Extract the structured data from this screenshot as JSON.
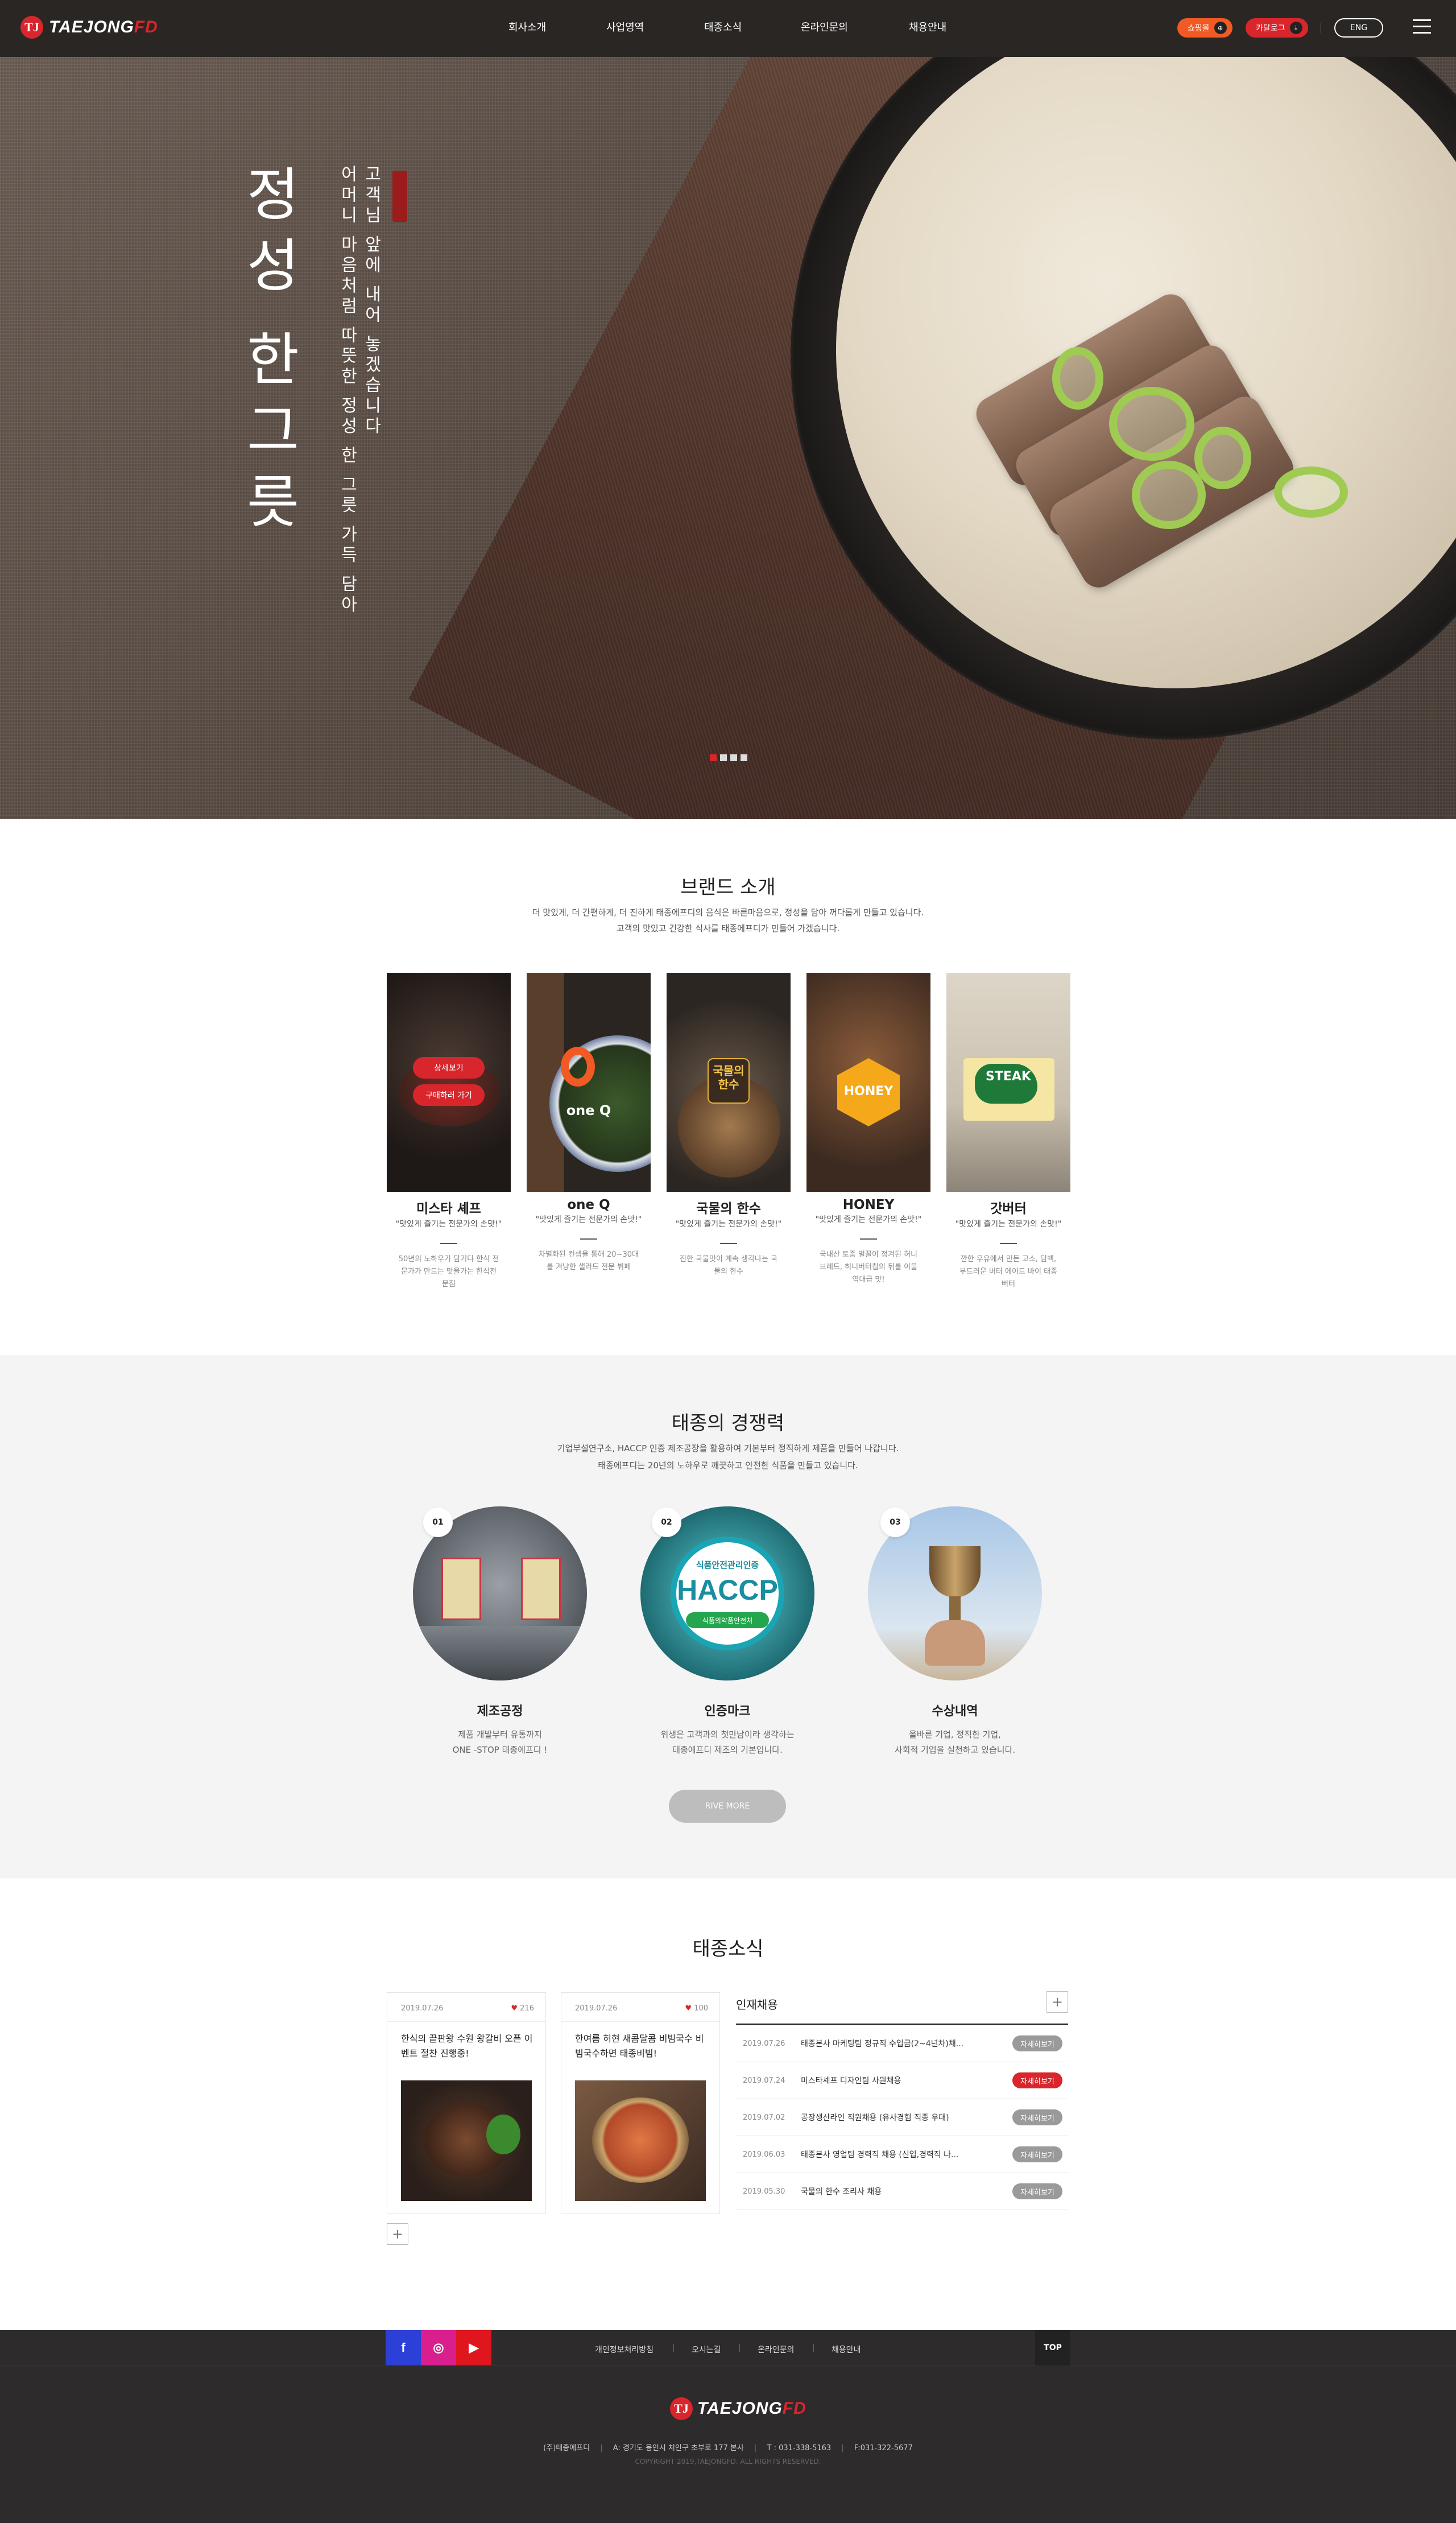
{
  "header": {
    "logo_text": "TAEJONG",
    "logo_accent": "FD",
    "logo_mark": "TJ",
    "nav": [
      "회사소개",
      "사업영역",
      "태종소식",
      "온라인문의",
      "채용안내"
    ],
    "btn_mall": "쇼핑몰",
    "btn_catalog": "카탈로그",
    "lang": "ENG",
    "accent_color": "#d8262c",
    "orange_color": "#f15a24"
  },
  "hero": {
    "title_chars": [
      "정",
      "성",
      "한",
      "그",
      "릇"
    ],
    "sub_line1": "고객님 앞에 내어 놓겠습니다",
    "sub_line2": "어머니 마음처럼 따뜻한 정성 한 그릇 가득 담아",
    "slides": 4,
    "active_slide": 1
  },
  "brand": {
    "title": "브랜드 소개",
    "desc1": "더 맛있게, 더 간편하게, 더 진하게 태종에프디의 음식은 바른마음으로, 정성을 담아 꺼다롭게 만들고 있습니다.",
    "desc2": "고객의 맛있고 건강한 식사를 태종에프디가 만들어 가겠습니다.",
    "btn_detail": "상세보기",
    "btn_buy": "구매하러 가기",
    "items": [
      {
        "name": "미스타 셰프",
        "tag": "\"맛있게 즐기는 전문가의 손맛!\"",
        "desc": "50년의 노하우가 담기다 한식 전문가가 만드는 맛을가는 한식전문점"
      },
      {
        "name": "one Q",
        "tag": "\"맛있게 즐기는 전문가의 손맛!\"",
        "desc": "차별화된 컨셉을 통해 20~30대 를 겨냥한 샐러드 전문 뷔페",
        "logo": "one Q"
      },
      {
        "name": "국물의 한수",
        "tag": "\"맛있게 즐기는 전문가의 손맛!\"",
        "desc": "진한 국물맛이 계속 생각나는 국물의 한수",
        "logo": "국물의 한수"
      },
      {
        "name": "HONEY",
        "tag": "\"맛있게 즐기는 전문가의 손맛!\"",
        "desc": "국내산 토종 벌꿀이 정겨된 허니브레드, 허니버터칩의 뒤를 이을 역대급 맛!",
        "logo": "HONEY"
      },
      {
        "name": "갓버터",
        "tag": "\"맛있게 즐기는 전문가의 손맛!\"",
        "desc": "깐한 우유에서 만든 고소, 담백, 부드러운 버터 에이드 바이 태종버터",
        "logo": "STEAK"
      }
    ]
  },
  "competitive": {
    "title": "태종의 경쟁력",
    "desc1": "기업부설연구소, HACCP 인증 제조공장을 활용하여 기본부터 정직하게 제품을 만들어 나갑니다.",
    "desc2": "태종에프디는 20년의 노하우로 깨끗하고 안전한 식품을 만들고 있습니다.",
    "items": [
      {
        "num": "01",
        "title": "제조공정",
        "desc1": "제품 개발부터 유통까지",
        "desc2": "ONE -STOP 태종에프디 !"
      },
      {
        "num": "02",
        "title": "인증마크",
        "desc1": "위생은 고객과의 첫만남이라 생각하는",
        "desc2": "태종에프디 제조의 기본입니다.",
        "haccp_top": "식품안전관리인증",
        "haccp": "HACCP",
        "haccp_bottom": "식품의약품안전처"
      },
      {
        "num": "03",
        "title": "수상내역",
        "desc1": "올바른 기업, 정직한 기업,",
        "desc2": "사회적 기업을 실천하고 있습니다."
      }
    ],
    "more": "RIVE MORE"
  },
  "news": {
    "title": "태종소식",
    "cards": [
      {
        "date": "2019.07.26",
        "likes": "216",
        "title": "한식의 끝판왕 수원 왕갈비 오픈 이벤트 절찬 진행중!"
      },
      {
        "date": "2019.07.26",
        "likes": "100",
        "title": "한여름 허현 새콤달콤 비빔국수 비빔국수하면 태종비빔!"
      }
    ],
    "jobs_title": "인재채용",
    "jobs": [
      {
        "date": "2019.07.26",
        "title": "태종본사 마케팅팀 정규직 수입금(2~4년차)채...",
        "btn": "자세히보기",
        "hot": false
      },
      {
        "date": "2019.07.24",
        "title": "미스타셰프 디자인팀 사원채용",
        "btn": "자세히보기",
        "hot": true
      },
      {
        "date": "2019.07.02",
        "title": "공장생산라인 직원채용 (유사경험 직종 우대)",
        "btn": "자세히보기",
        "hot": false
      },
      {
        "date": "2019.06.03",
        "title": "태종본사 영업팀 경력직 채용 (신입,경력직 나...",
        "btn": "자세히보기",
        "hot": false
      },
      {
        "date": "2019.05.30",
        "title": "국물의 한수 조리사 채용",
        "btn": "자세히보기",
        "hot": false
      }
    ]
  },
  "footer": {
    "links": [
      "개인정보처리방침",
      "오시는길",
      "온라인문의",
      "채용안내"
    ],
    "top": "TOP",
    "company": "(주)태종에프디",
    "address": "A: 경기도 용인시 처인구 초부로 177 본사",
    "tel": "T : 031-338-5163",
    "fax": "F:031-322-5677",
    "copyright": "COPYRIGHT 2019,TAEJONGFD. ALL RIGHTS RESERVED."
  }
}
